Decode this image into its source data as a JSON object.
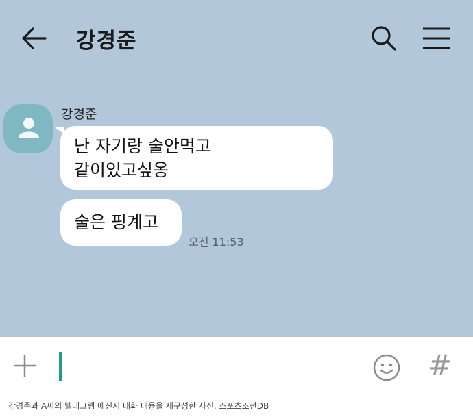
{
  "header": {
    "title": "강경준",
    "back_icon": "arrow-left-icon",
    "search_icon": "search-icon",
    "menu_icon": "hamburger-menu-icon"
  },
  "chat": {
    "sender_name": "강경준",
    "messages": [
      {
        "text": "난 자기랑 술안먹고\n같이있고싶옹"
      },
      {
        "text": "술은 핑계고"
      }
    ],
    "timestamp": "오전 11:53"
  },
  "input_bar": {
    "plus_icon": "plus-icon",
    "emoji_icon": "emoji-icon",
    "hash_label": "#"
  },
  "caption": "강경준과 A씨의 텔레그램 메신저 대화 내용을 재구성한 사진. 스포츠조선DB",
  "colors": {
    "chat_background": "#b2c7da",
    "avatar": "#7fb8c3",
    "bubble": "#ffffff",
    "cursor": "#1f9c82"
  }
}
